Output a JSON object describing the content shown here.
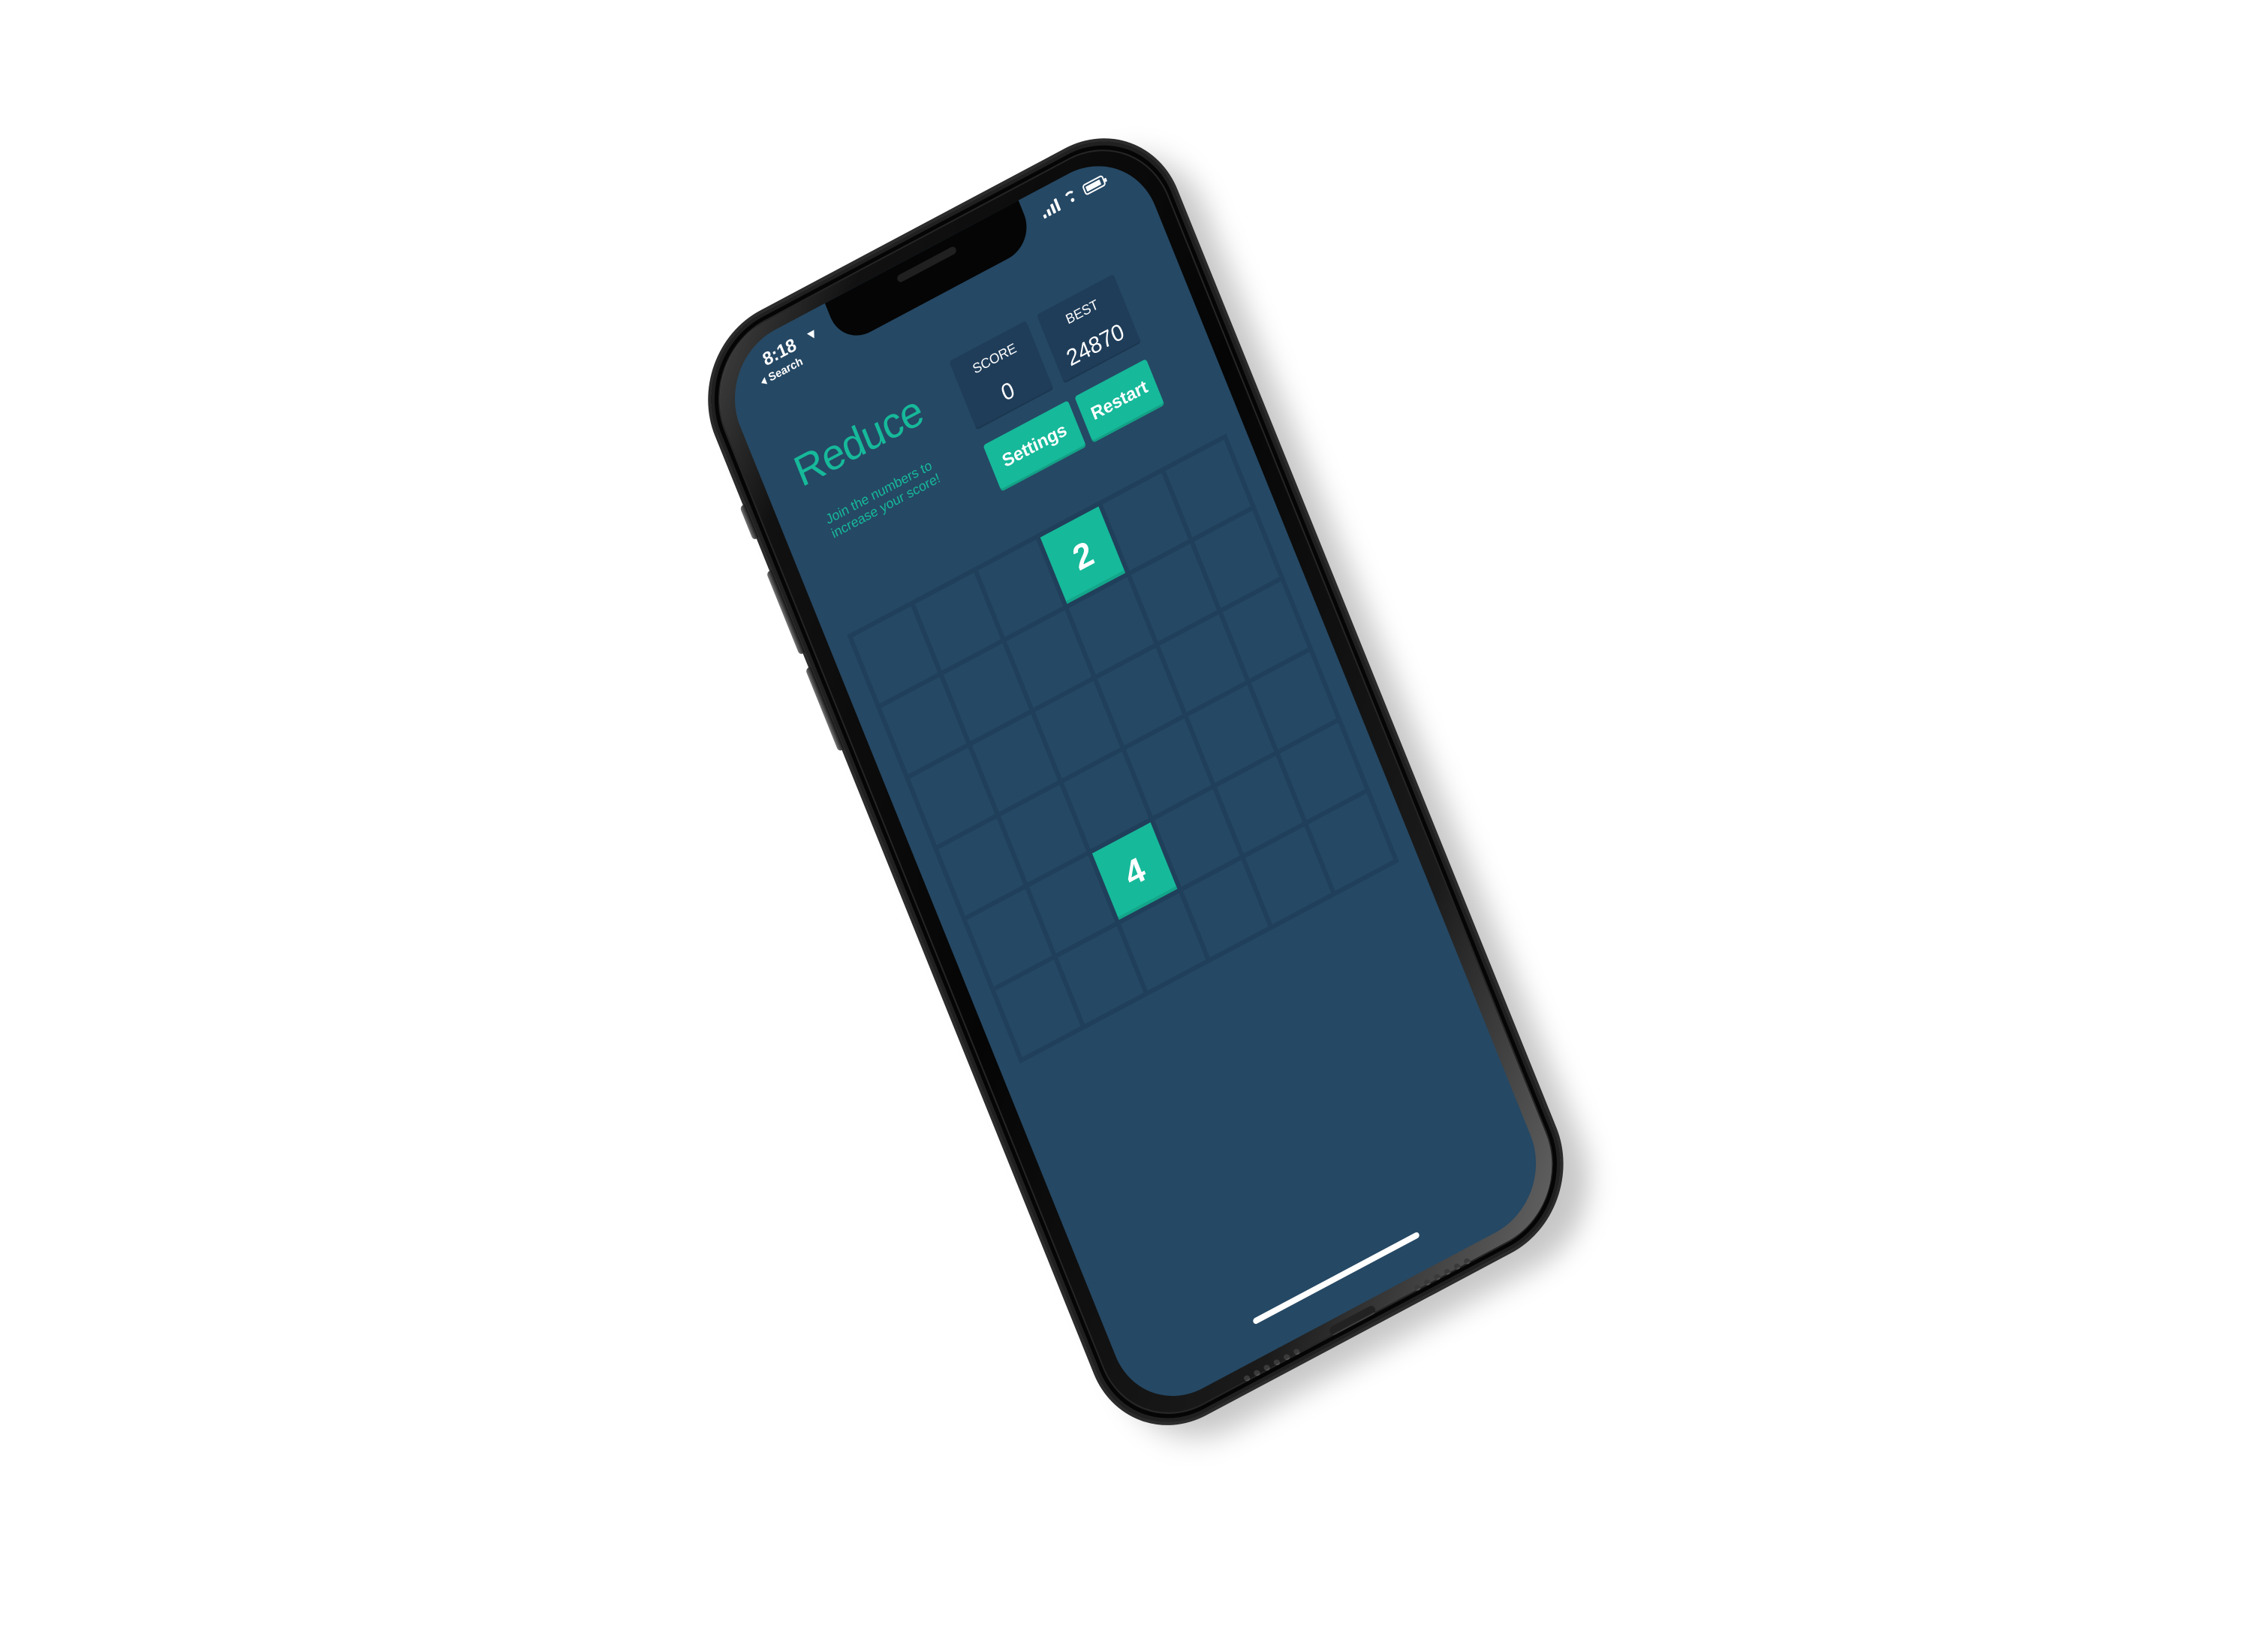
{
  "status_bar": {
    "time": "8:18",
    "back_label": "Search",
    "icons": [
      "location-icon",
      "signal-icon",
      "wifi-icon",
      "battery-icon"
    ]
  },
  "app": {
    "title": "Reduce",
    "subtitle": "Join the numbers to increase your score!",
    "score_label": "SCORE",
    "score_value": "0",
    "best_label": "BEST",
    "best_value": "24870",
    "settings_label": "Settings",
    "restart_label": "Restart",
    "board": [
      [
        "",
        "",
        "",
        "2",
        "",
        ""
      ],
      [
        "",
        "",
        "",
        "",
        "",
        ""
      ],
      [
        "",
        "",
        "",
        "",
        "",
        ""
      ],
      [
        "",
        "",
        "",
        "",
        "",
        ""
      ],
      [
        "",
        "",
        "4",
        "",
        "",
        ""
      ],
      [
        "",
        "",
        "",
        "",
        "",
        ""
      ]
    ]
  },
  "colors": {
    "screen_background": "#254864",
    "accent": "#16b99a",
    "tile_background": "#16b99a",
    "panel_background": "#1f3d59",
    "device": "#050505",
    "page_background": "#ffffff"
  }
}
